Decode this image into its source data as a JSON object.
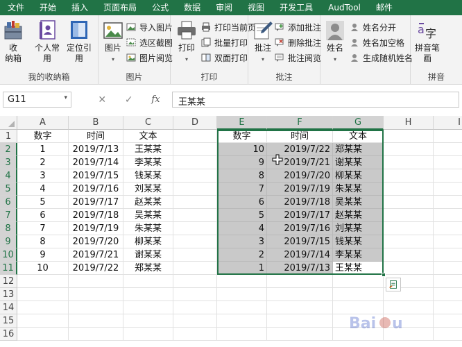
{
  "menu": [
    "文件",
    "开始",
    "插入",
    "页面布局",
    "公式",
    "数据",
    "审阅",
    "视图",
    "开发工具",
    "AudTool",
    "邮件"
  ],
  "ribbon": {
    "g1": {
      "label": "我的收纳箱",
      "btn_collect": "收\n纳箱",
      "btn_personal": "个人常\n用",
      "btn_locate": "定位引\n用"
    },
    "g2": {
      "label": "图片",
      "btn_picture": "图片",
      "items": [
        "导入图片",
        "选区截图",
        "图片阅览"
      ]
    },
    "g3": {
      "label": "打印",
      "btn_print": "打印",
      "items": [
        "打印当前页",
        "批量打印",
        "双面打印"
      ]
    },
    "g4": {
      "label": "批注",
      "btn_comment": "批注",
      "items": [
        "添加批注",
        "删除批注",
        "批注阅览"
      ]
    },
    "g5": {
      "label": "",
      "btn_name": "姓名",
      "items": [
        "姓名分开",
        "姓名加空格",
        "生成随机姓名"
      ]
    },
    "g6": {
      "label": "拼音",
      "btn_pinyin": "拼音笔\n画"
    }
  },
  "formula_bar": {
    "name_box": "G11",
    "value": "王某某"
  },
  "columns": [
    "A",
    "B",
    "C",
    "D",
    "E",
    "F",
    "G",
    "H",
    "I"
  ],
  "rows": [
    "1",
    "2",
    "3",
    "4",
    "5",
    "6",
    "7",
    "8",
    "9",
    "10",
    "11",
    "12",
    "13",
    "14",
    "15",
    "16"
  ],
  "left_table": {
    "headers": [
      "数字",
      "时间",
      "文本"
    ],
    "rows": [
      [
        "1",
        "2019/7/13",
        "王某某"
      ],
      [
        "2",
        "2019/7/14",
        "李某某"
      ],
      [
        "3",
        "2019/7/15",
        "钱某某"
      ],
      [
        "4",
        "2019/7/16",
        "刘某某"
      ],
      [
        "5",
        "2019/7/17",
        "赵某某"
      ],
      [
        "6",
        "2019/7/18",
        "吴某某"
      ],
      [
        "7",
        "2019/7/19",
        "朱某某"
      ],
      [
        "8",
        "2019/7/20",
        "柳某某"
      ],
      [
        "9",
        "2019/7/21",
        "谢某某"
      ],
      [
        "10",
        "2019/7/22",
        "郑某某"
      ]
    ]
  },
  "right_table": {
    "headers": [
      "数字",
      "时间",
      "文本"
    ],
    "rows": [
      [
        "10",
        "2019/7/22",
        "郑某某"
      ],
      [
        "9",
        "2019/7/21",
        "谢某某"
      ],
      [
        "8",
        "2019/7/20",
        "柳某某"
      ],
      [
        "7",
        "2019/7/19",
        "朱某某"
      ],
      [
        "6",
        "2019/7/18",
        "吴某某"
      ],
      [
        "5",
        "2019/7/17",
        "赵某某"
      ],
      [
        "4",
        "2019/7/16",
        "刘某某"
      ],
      [
        "3",
        "2019/7/15",
        "钱某某"
      ],
      [
        "2",
        "2019/7/14",
        "李某某"
      ],
      [
        "1",
        "2019/7/13",
        "王某某"
      ]
    ]
  },
  "selection": {
    "range": "E2:G11",
    "active_cell": "G11"
  },
  "colors": {
    "excel_green": "#217346",
    "highlight_gray": "#c9c9c9",
    "ribbon_bg": "#f3f3f3"
  }
}
